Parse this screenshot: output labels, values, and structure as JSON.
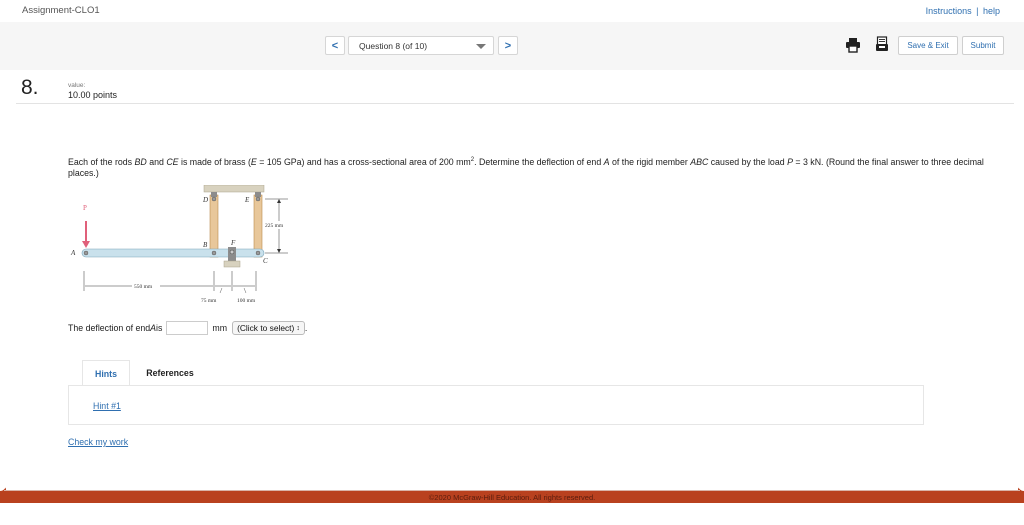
{
  "topbar": {
    "assignment_title": "Assignment-CLO1",
    "instructions_link": "Instructions",
    "separator": "|",
    "help_link": "help"
  },
  "nav": {
    "prev_icon": "chevron-left-icon",
    "prev_glyph": "<",
    "question_selector": "Question 8 (of 10)",
    "next_icon": "chevron-right-icon",
    "next_glyph": ">",
    "print_icon": "print-icon",
    "save_icon": "save-icon",
    "save_exit_label": "Save & Exit",
    "submit_label": "Submit"
  },
  "question": {
    "number": "8.",
    "value_label": "value:",
    "points": "10.00 points",
    "text_parts": {
      "p1": "Each of the rods ",
      "bd": "BD",
      "p2": " and ",
      "ce": "CE",
      "p3": " is made of brass (",
      "e": "E",
      "p4": " = 105 GPa) and has a cross-sectional area of 200 mm",
      "sup": "2",
      "p5": ". Determine the deflection of end ",
      "a": "A",
      "p6": " of the rigid member ",
      "abc": "ABC",
      "p7": " caused by the load ",
      "p": "P",
      "p8": " = 3 kN. (Round the final answer to three decimal places.)"
    },
    "figure": {
      "load_label": "P",
      "point_a": "A",
      "point_b": "B",
      "point_c": "C",
      "point_d": "D",
      "point_e": "E",
      "point_f": "F",
      "dim_550": "550 mm",
      "dim_75": "75 mm",
      "dim_100": "100 mm",
      "dim_225": "225 mm"
    },
    "answer": {
      "prefix": "The deflection of end ",
      "var": "A",
      "is": " is",
      "input_value": "",
      "unit": "mm",
      "select_value": "(Click to select)",
      "select_glyph": "↕",
      "suffix": "."
    }
  },
  "tabs": [
    {
      "label": "Hints",
      "active": true
    },
    {
      "label": "References",
      "active": false
    }
  ],
  "hint_link": "Hint #1",
  "check_link": "Check my work",
  "footer": {
    "copyright": "©2020 McGraw-Hill Education. All rights reserved."
  },
  "colors": {
    "link": "#2f6fb0",
    "footer_bar": "#b9411f",
    "load_arrow": "#e0607a",
    "rod": "#e8c79a",
    "beam": "#c9e1ec"
  }
}
